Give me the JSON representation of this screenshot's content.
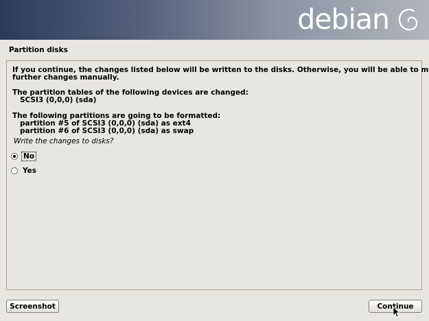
{
  "banner": {
    "wordmark": "debian",
    "logo_icon": "debian-swirl-icon"
  },
  "page": {
    "title": "Partition disks"
  },
  "content": {
    "intro_line1": "If you continue, the changes listed below will be written to the disks. Otherwise, you will be able to make",
    "intro_line2": "further changes manually.",
    "tables_heading": "The partition tables of the following devices are changed:",
    "tables_device": "   SCSI3 (0,0,0) (sda)",
    "format_heading": "The following partitions are going to be formatted:",
    "format_items": [
      "   partition #5 of SCSI3 (0,0,0) (sda) as ext4",
      "   partition #6 of SCSI3 (0,0,0) (sda) as swap"
    ],
    "question": "Write the changes to disks?"
  },
  "options": [
    {
      "label": "No",
      "selected": true
    },
    {
      "label": "Yes",
      "selected": false
    }
  ],
  "buttons": {
    "screenshot": "Screenshot",
    "continue": "Continue"
  },
  "colors": {
    "banner_dark": "#2b3b58",
    "banner_light": "#b1b5bc",
    "background": "#e8e6e0"
  }
}
